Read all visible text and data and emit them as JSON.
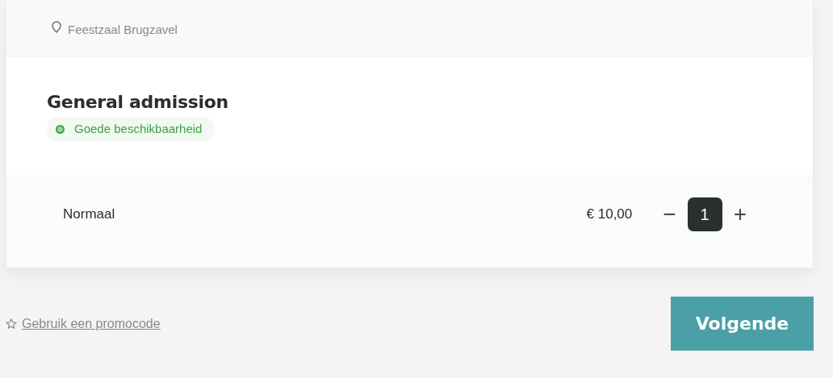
{
  "venue": {
    "name": "Feestzaal Brugzavel"
  },
  "section": {
    "title": "General admission",
    "availability": "Goede beschikbaarheid"
  },
  "tickets": [
    {
      "name": "Normaal",
      "price": "€ 10,00",
      "minus": "−",
      "quantity": "1",
      "plus": "+"
    }
  ],
  "promo_link": "Gebruik een promocode",
  "next_button": "Volgende"
}
